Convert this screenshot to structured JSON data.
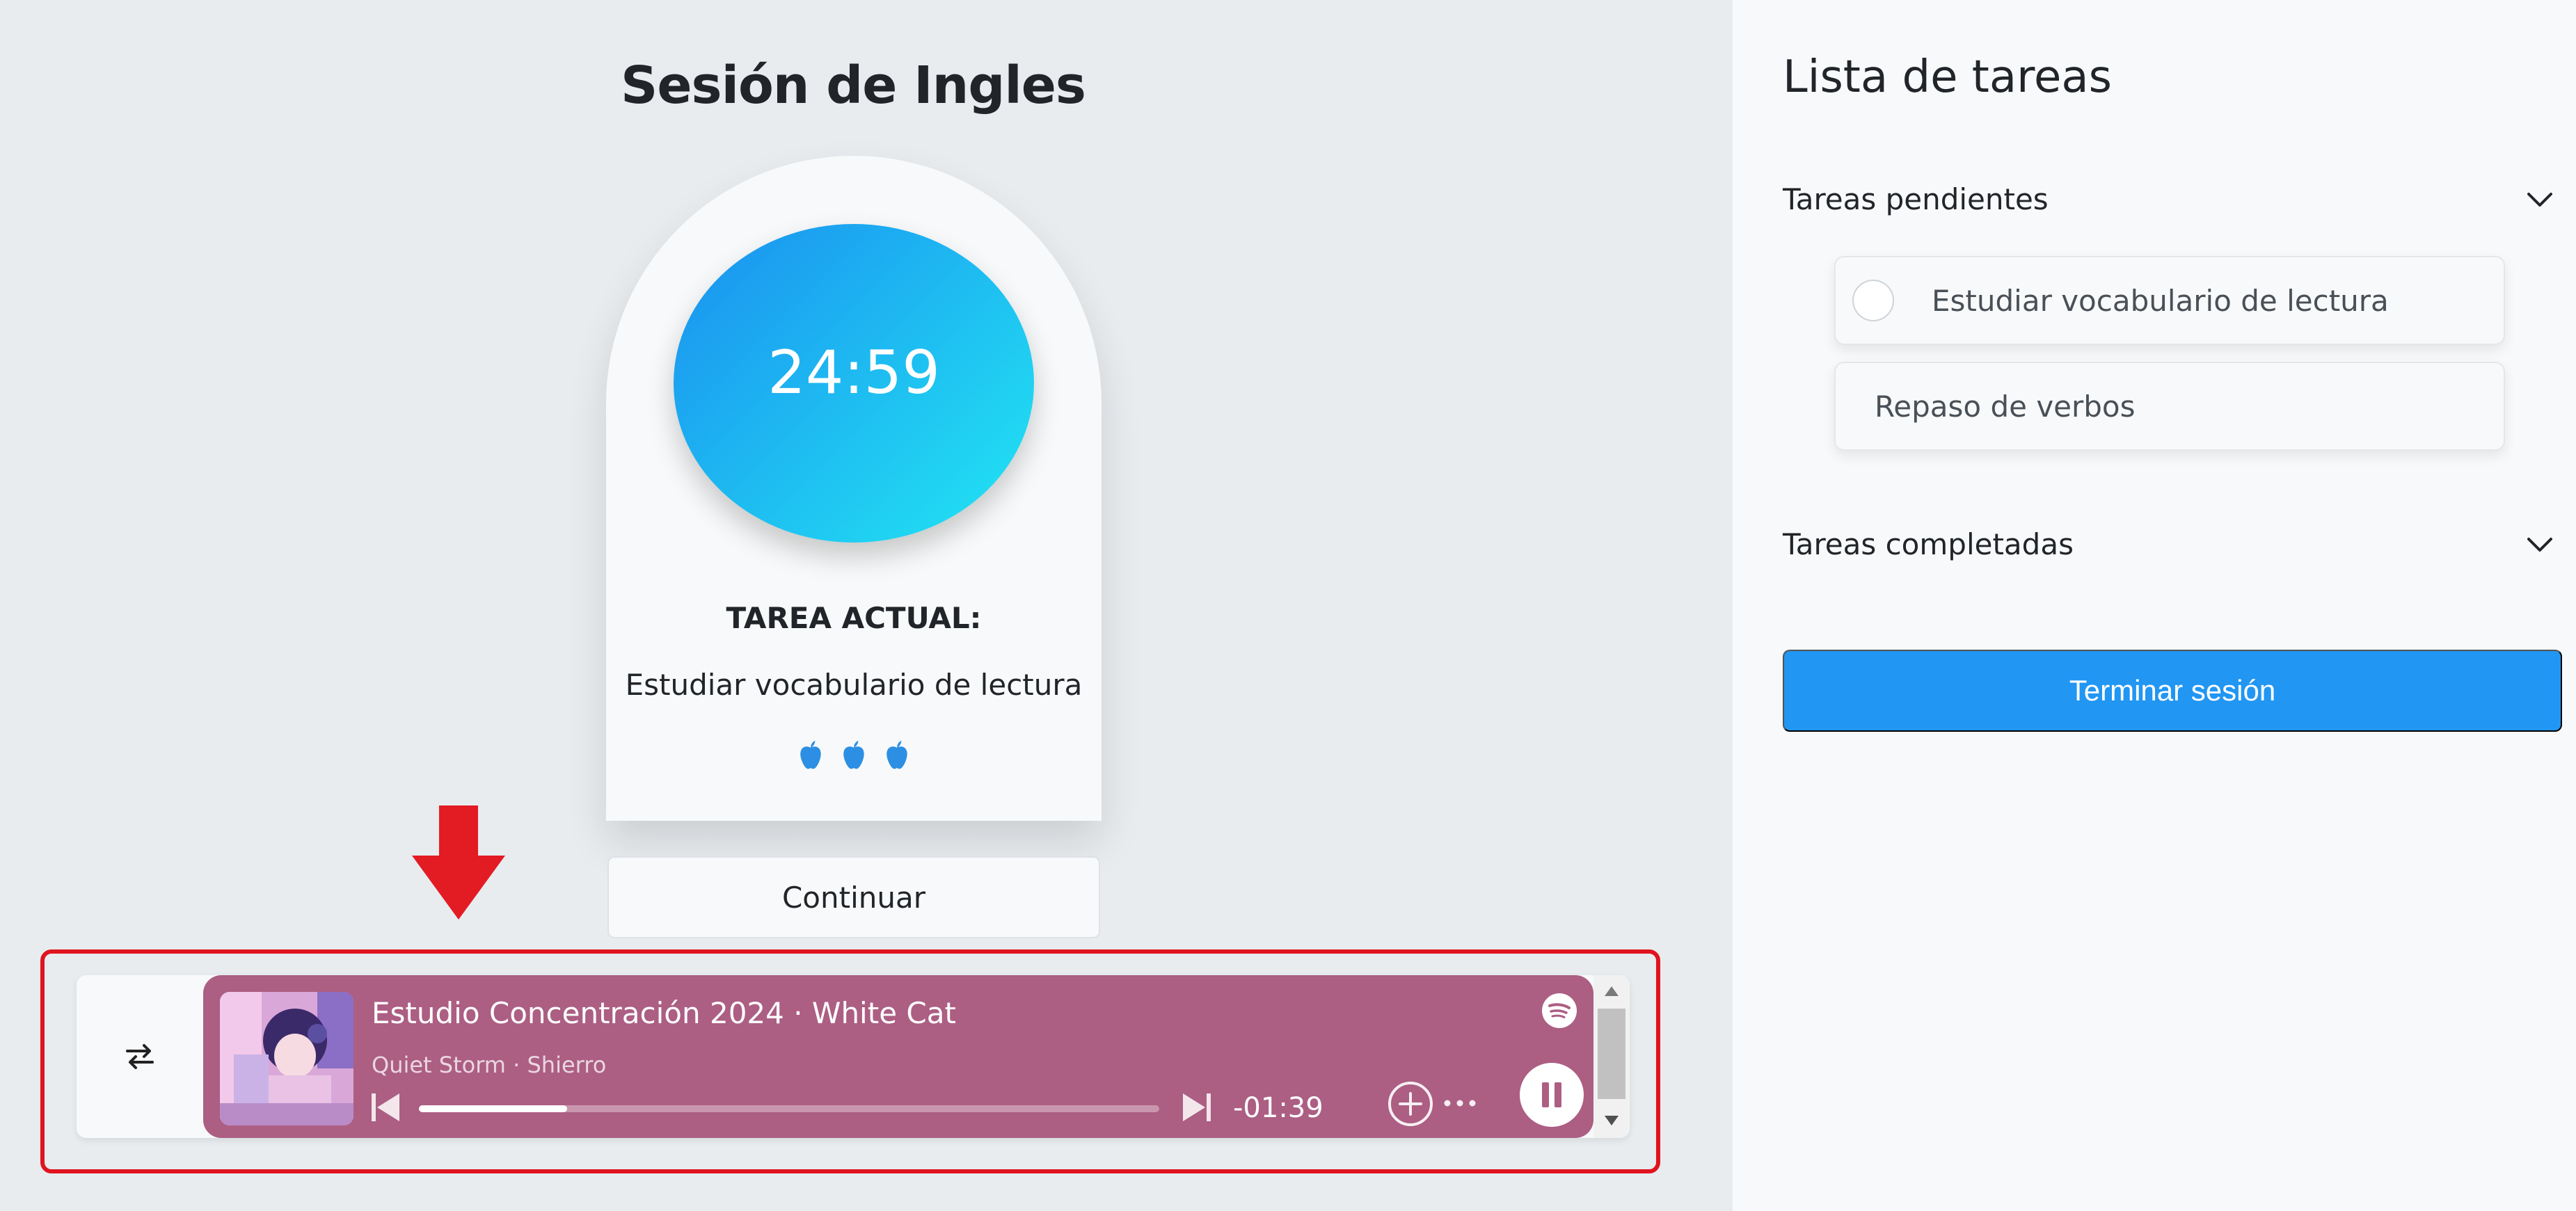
{
  "session": {
    "title": "Sesión de Ingles"
  },
  "timer": {
    "value": "24:59",
    "task_heading": "TAREA ACTUAL:",
    "task_name": "Estudiar vocabulario de lectura",
    "pomodoro_count": 3,
    "pomodoro_icon": "apple-icon",
    "continue_label": "Continuar"
  },
  "player": {
    "track_title": "Estudio Concentración 2024 · White Cat",
    "track_subtitle": "Quiet Storm · Shierro",
    "time_remaining": "-01:39",
    "progress_fraction": 0.2,
    "accent_color": "#ac5e83"
  },
  "sidebar": {
    "title": "Lista de tareas",
    "pending_label": "Tareas pendientes",
    "pending_tasks": [
      {
        "label": "Estudiar vocabulario de lectura"
      },
      {
        "label": "Repaso de verbos"
      }
    ],
    "completed_label": "Tareas completadas",
    "end_button_label": "Terminar sesión"
  },
  "colors": {
    "primary": "#2196f3",
    "timer_gradient_start": "#1a8ff0",
    "timer_gradient_end": "#22e6f2",
    "highlight": "#e0141e"
  }
}
